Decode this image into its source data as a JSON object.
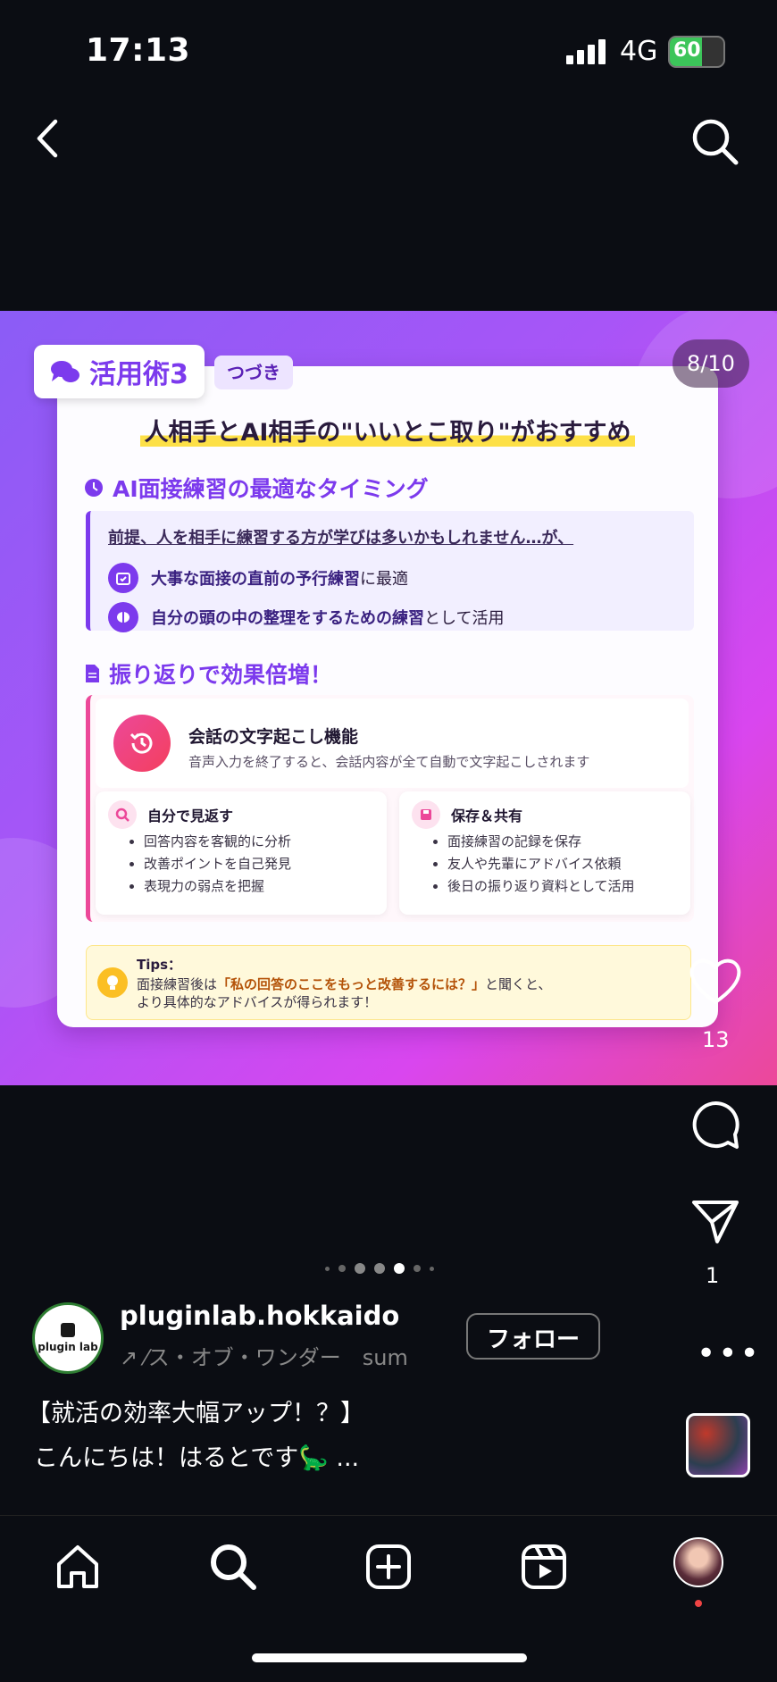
{
  "status": {
    "time": "17:13",
    "network": "4G",
    "battery": "60",
    "battery_level": 0.6
  },
  "post_image": {
    "badge": "活用術3",
    "continued": "つづき",
    "pager": "8/10",
    "headline": "人相手とAI相手の\"いいとこ取り\"がおすすめ",
    "section1": {
      "title": "AI面接練習の最適なタイミング",
      "premise": "前提、人を相手に練習する方が学びは多いかもしれません…が、",
      "row1_bold": "大事な面接の直前の予行練習",
      "row1_rest": "に最適",
      "row2_bold": "自分の頭の中の整理をするための練習",
      "row2_rest": "として活用"
    },
    "section2": {
      "title": "振り返りで効果倍増！",
      "feature_title": "会話の文字起こし機能",
      "feature_desc": "音声入力を終了すると、会話内容が全て自動で文字起こしされます",
      "left_title": "自分で見返す",
      "left_items": [
        "回答内容を客観的に分析",
        "改善ポイントを自己発見",
        "表現力の弱点を把握"
      ],
      "right_title": "保存＆共有",
      "right_items": [
        "面接練習の記録を保存",
        "友人や先輩にアドバイス依頼",
        "後日の振り返り資料として活用"
      ]
    },
    "tips": {
      "title": "Tips：",
      "line1_a": "面接練習後は",
      "line1_quote": "「私の回答のここをもっと改善するには？」",
      "line1_b": "と聞くと、",
      "line2": "より具体的なアドバイスが得られます！"
    }
  },
  "actions": {
    "likes": "13",
    "shares": "1"
  },
  "account": {
    "username": "pluginlab.hokkaido",
    "avatar_text": "plugin lab",
    "song": "↗ ⁄ス・オブ・ワンダー　sum",
    "follow": "フォロー"
  },
  "caption": {
    "line1": "【就活の効率大幅アップ！？】",
    "line2": "こんにちは！はるとです🦕 ..."
  },
  "colors": {
    "accent": "#7c3aed",
    "pink": "#ec4899",
    "background": "#0b0d13"
  }
}
